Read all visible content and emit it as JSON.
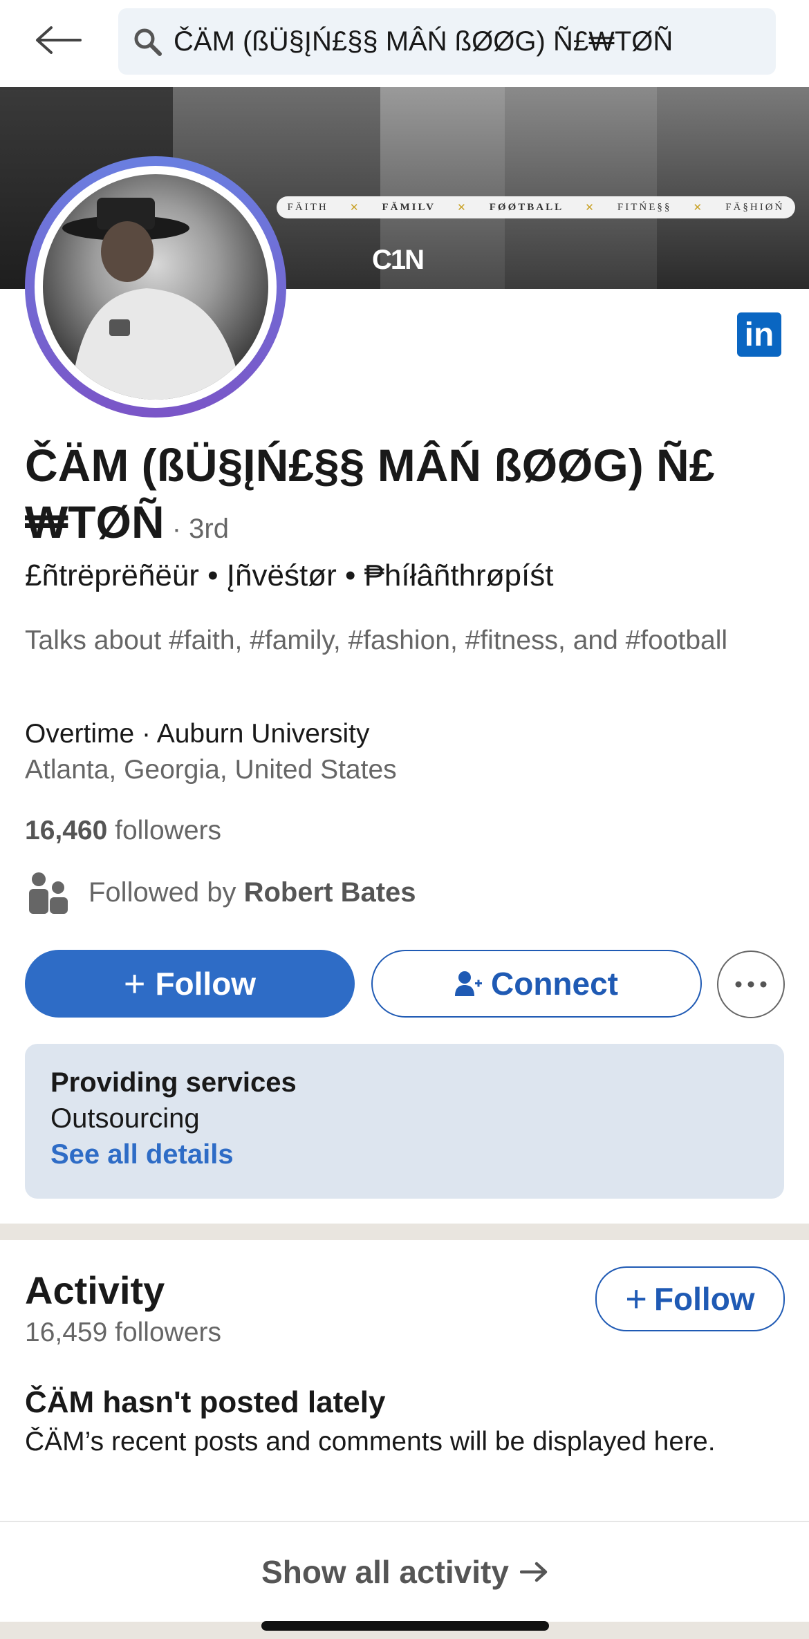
{
  "search": {
    "query": "ČÄM (ßÜ§ĮŃ£§§ MÂŃ ßØØG) Ñ£₩TØÑ"
  },
  "banner": {
    "tagline": [
      "FÄITH",
      "FÄMILV",
      "FØØTBALL",
      "FITŃE§§",
      "FÄ§HIØŃ"
    ],
    "separator": "✕",
    "monogram": "C1N"
  },
  "profile": {
    "name": "ČÄM (ßÜ§ĮŃ£§§ MÂŃ ßØØG) Ñ£₩TØÑ",
    "degree": " · 3rd",
    "headline": "£ñtrëprëñëür • Įñvëśtør • ₱híłâñthrøpíśt",
    "talks_about": "Talks about #faith, #family, #fashion, #fitness, and #football",
    "org": "Overtime · Auburn University",
    "location": "Atlanta, Georgia, United States",
    "followers_count": "16,460",
    "followers_label": " followers",
    "followed_by_prefix": "Followed by ",
    "followed_by_name": "Robert Bates"
  },
  "actions": {
    "follow": "Follow",
    "connect": "Connect"
  },
  "services": {
    "title": "Providing services",
    "value": "Outsourcing",
    "link": "See all details"
  },
  "activity": {
    "title": "Activity",
    "followers": "16,459 followers",
    "follow": "Follow",
    "empty_title": "ČÄM hasn't posted lately",
    "empty_sub": "ČÄM’s recent posts and comments will be displayed here.",
    "show_all": "Show all activity"
  },
  "colors": {
    "brand": "#2e6cc6",
    "linkedin": "#0a66c2",
    "services_bg": "#dde5ef"
  }
}
